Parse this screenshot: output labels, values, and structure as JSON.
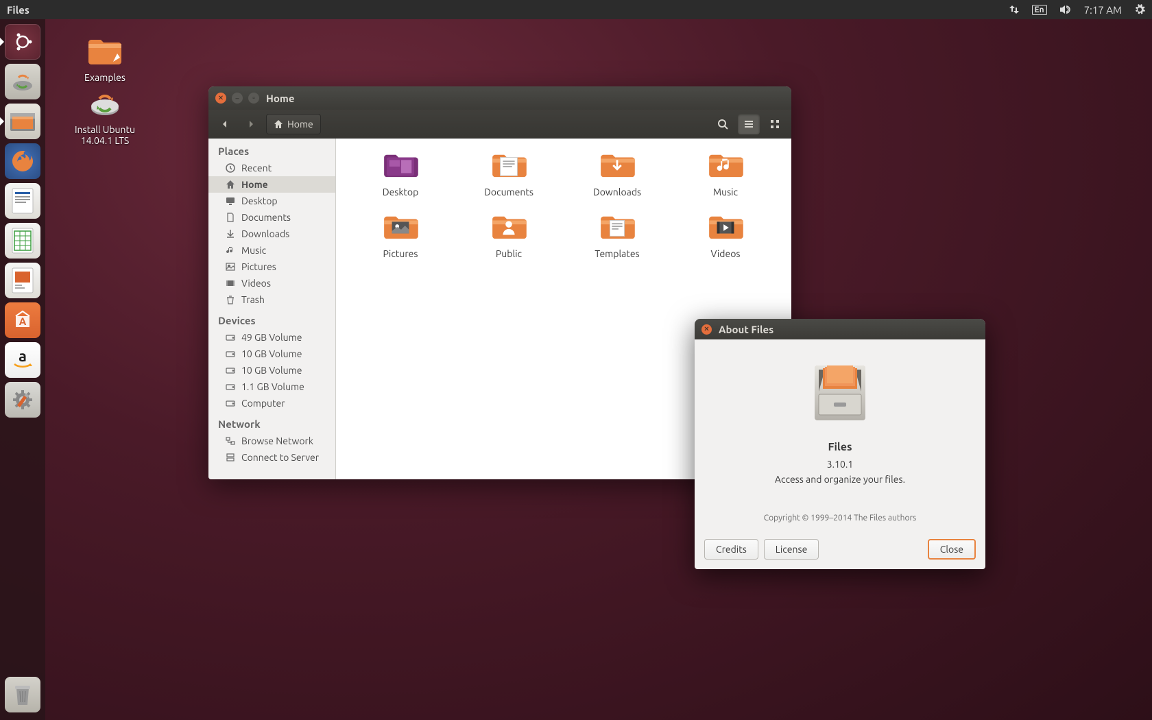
{
  "top_panel": {
    "app_name": "Files",
    "lang": "En",
    "time": "7:17 AM"
  },
  "desktop": {
    "examples": "Examples",
    "install": "Install Ubuntu 14.04.1 LTS"
  },
  "files_window": {
    "title": "Home",
    "path_label": "Home",
    "sidebar": {
      "places_header": "Places",
      "places": [
        {
          "label": "Recent",
          "icon": "clock"
        },
        {
          "label": "Home",
          "icon": "home",
          "selected": true
        },
        {
          "label": "Desktop",
          "icon": "desktop"
        },
        {
          "label": "Documents",
          "icon": "doc"
        },
        {
          "label": "Downloads",
          "icon": "down"
        },
        {
          "label": "Music",
          "icon": "music"
        },
        {
          "label": "Pictures",
          "icon": "pic"
        },
        {
          "label": "Videos",
          "icon": "video"
        },
        {
          "label": "Trash",
          "icon": "trash"
        }
      ],
      "devices_header": "Devices",
      "devices": [
        {
          "label": "49 GB Volume"
        },
        {
          "label": "10 GB Volume"
        },
        {
          "label": "10 GB Volume"
        },
        {
          "label": "1.1 GB Volume"
        },
        {
          "label": "Computer"
        }
      ],
      "network_header": "Network",
      "network": [
        {
          "label": "Browse Network"
        },
        {
          "label": "Connect to Server"
        }
      ]
    },
    "folders": [
      {
        "label": "Desktop"
      },
      {
        "label": "Documents"
      },
      {
        "label": "Downloads"
      },
      {
        "label": "Music"
      },
      {
        "label": "Pictures"
      },
      {
        "label": "Public"
      },
      {
        "label": "Templates"
      },
      {
        "label": "Videos"
      }
    ]
  },
  "about": {
    "title": "About Files",
    "app": "Files",
    "version": "3.10.1",
    "desc": "Access and organize your files.",
    "copyright": "Copyright © 1999–2014 The Files authors",
    "credits": "Credits",
    "license": "License",
    "close": "Close"
  }
}
